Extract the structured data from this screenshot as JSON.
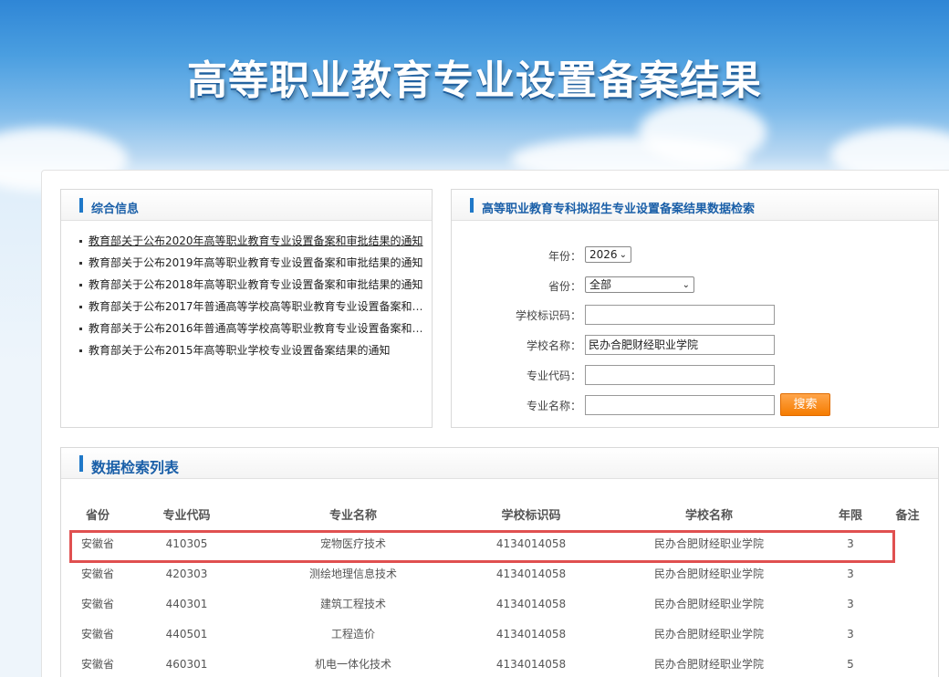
{
  "header": {
    "title": "高等职业教育专业设置备案结果"
  },
  "news_panel": {
    "title": "综合信息",
    "items": [
      "教育部关于公布2020年高等职业教育专业设置备案和审批结果的通知",
      "教育部关于公布2019年高等职业教育专业设置备案和审批结果的通知",
      "教育部关于公布2018年高等职业教育专业设置备案和审批结果的通知",
      "教育部关于公布2017年普通高等学校高等职业教育专业设置备案和审…",
      "教育部关于公布2016年普通高等学校高等职业教育专业设置备案和审…",
      "教育部关于公布2015年高等职业学校专业设置备案结果的通知"
    ]
  },
  "search_panel": {
    "title": "高等职业教育专科拟招生专业设置备案结果数据检索",
    "year_label": "年份：",
    "year_value": "2026",
    "province_label": "省份：",
    "province_value": "全部",
    "school_code_label": "学校标识码：",
    "school_code_value": "",
    "school_name_label": "学校名称：",
    "school_name_value": "民办合肥财经职业学院",
    "major_code_label": "专业代码：",
    "major_code_value": "",
    "major_name_label": "专业名称：",
    "major_name_value": "",
    "search_button": "搜索"
  },
  "results": {
    "title": "数据检索列表",
    "columns": [
      "省份",
      "专业代码",
      "专业名称",
      "学校标识码",
      "学校名称",
      "年限",
      "备注"
    ],
    "rows": [
      [
        "安徽省",
        "410305",
        "宠物医疗技术",
        "4134014058",
        "民办合肥财经职业学院",
        "3",
        ""
      ],
      [
        "安徽省",
        "420303",
        "测绘地理信息技术",
        "4134014058",
        "民办合肥财经职业学院",
        "3",
        ""
      ],
      [
        "安徽省",
        "440301",
        "建筑工程技术",
        "4134014058",
        "民办合肥财经职业学院",
        "3",
        ""
      ],
      [
        "安徽省",
        "440501",
        "工程造价",
        "4134014058",
        "民办合肥财经职业学院",
        "3",
        ""
      ],
      [
        "安徽省",
        "460301",
        "机电一体化技术",
        "4134014058",
        "民办合肥财经职业学院",
        "5",
        ""
      ]
    ],
    "highlight_color": "#e05050"
  },
  "colors": {
    "accent": "#1f78c8",
    "button": "#f57c00"
  }
}
